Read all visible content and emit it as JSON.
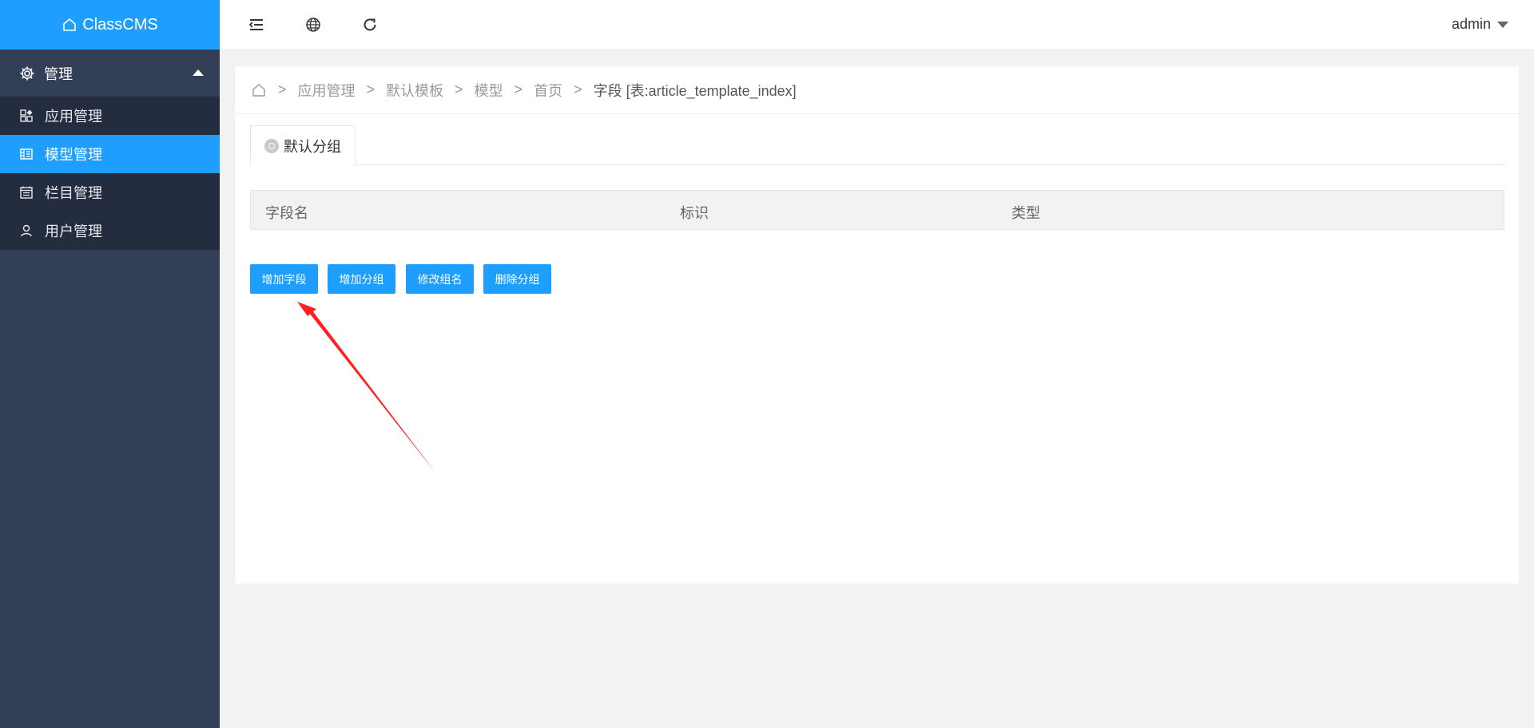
{
  "app": {
    "logo_text": "ClassCMS"
  },
  "sidebar": {
    "group": {
      "label": "管理",
      "icon": "gear-icon"
    },
    "items": [
      {
        "label": "应用管理",
        "icon": "apps-icon",
        "active": false
      },
      {
        "label": "模型管理",
        "icon": "model-icon",
        "active": true
      },
      {
        "label": "栏目管理",
        "icon": "column-icon",
        "active": false
      },
      {
        "label": "用户管理",
        "icon": "user-icon",
        "active": false
      }
    ]
  },
  "topbar": {
    "icons": [
      "collapse-menu-icon",
      "globe-icon",
      "refresh-icon"
    ],
    "user": "admin"
  },
  "breadcrumb": {
    "items": [
      "应用管理",
      "默认模板",
      "模型",
      "首页"
    ],
    "current": "字段 [表:article_template_index]",
    "separator": ">"
  },
  "tabs": [
    {
      "label": "默认分组"
    }
  ],
  "table": {
    "columns": [
      "字段名",
      "标识",
      "类型"
    ],
    "rows": []
  },
  "buttons": {
    "add_field": "增加字段",
    "add_group": "增加分组",
    "rename_group": "修改组名",
    "delete_group": "删除分组"
  },
  "colors": {
    "accent": "#1e9fff",
    "sidebar": "#323f57",
    "sidebar_sub": "#232d3f",
    "annotation": "#ff2020"
  }
}
